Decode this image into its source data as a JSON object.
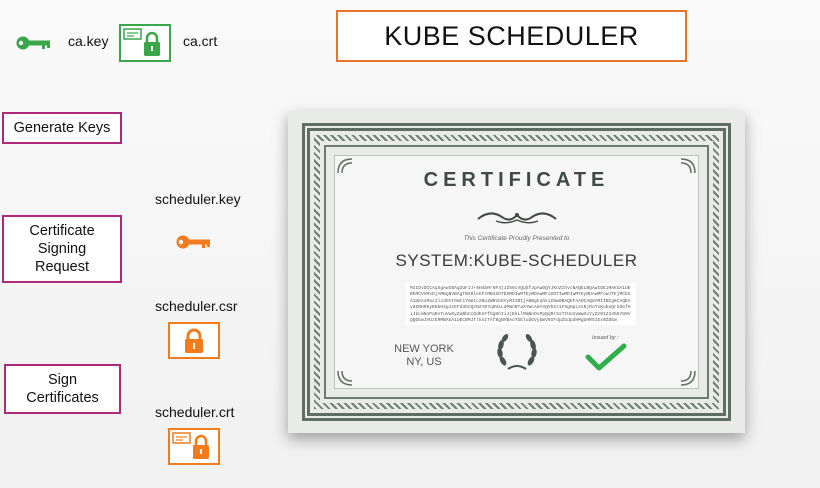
{
  "header": {
    "title": "KUBE SCHEDULER"
  },
  "ca": {
    "key_label": "ca.key",
    "cert_label": "ca.crt"
  },
  "steps": {
    "generate_keys": "Generate Keys",
    "csr_line1": "Certificate",
    "csr_line2": "Signing",
    "csr_line3": "Request",
    "sign_line1": "Sign",
    "sign_line2": "Certificates"
  },
  "files": {
    "key": "scheduler.key",
    "csr": "scheduler.csr",
    "crt": "scheduler.crt"
  },
  "certificate": {
    "heading": "CERTIFICATE",
    "subtitle": "This Certificate Proudly Presented to",
    "name": "SYSTEM:KUBE-SCHEDULER",
    "key_text": "MIIDvDCCAqSgAwIBAgIUFJJ+9H4bRrNF4jJZ56cVQq5fJpAwDQYJKoZIhvcNAQELBQAwIDEiMAkGA1UEBhMCVVMxDjAMBgNVBAgTBXRleGFzMB4XDTE5MDIwMTEyMDAwMFoXDTIwMDIwMTEyMDAwMFowJTEjMCEGA1UEAxMac3lzdGVtOmt1YmUtc2NoZWR1bGVyMIIBIjANBgkqhkiG9w0BAQEFAAOCAQ8AMIIBCgKCAQEAy8ZNHR5yKNbH4gJzEFd3bCQzN2YB7q9UkLdPWnRTaXYWcAmYeQVbXz1F6gHpL2sNjRoTvKuEeQrSdGfHiJkLmNoPqRsTuVwXyZaBbCcDdEeFfGgHhIiJjKkLlMmNnOoPpQqRrSsTtUuVvWwXxYyZz0123456789VQQGEwJVUzERMBAGA1UECBMJTlkxITAfBgNVBAoTGEludGVybmV0IFdpZGdpdHMgUHR5IEx0ZDEw",
    "location_line1": "NEW YORK",
    "location_line2": "NY, US",
    "issued_by": "Issued by :"
  },
  "colors": {
    "title_border": "#e8732a",
    "step_border": "#b0287a",
    "ca_green": "#3aa64a",
    "file_orange": "#f07c1e",
    "check_green": "#2fae4b"
  },
  "icons": {
    "ca_key": "key-icon",
    "ca_cert": "certificate-lock-icon",
    "scheduler_key": "key-icon",
    "scheduler_csr": "lock-icon",
    "scheduler_crt": "certificate-lock-icon"
  }
}
